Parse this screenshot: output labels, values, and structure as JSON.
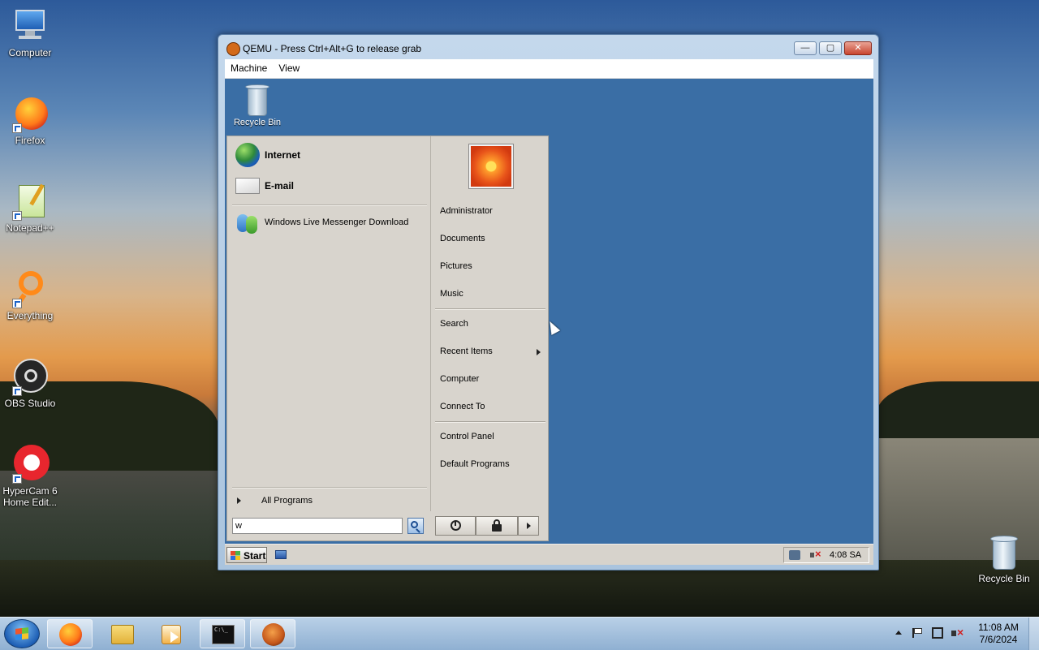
{
  "host_desktop": {
    "icons": [
      {
        "label": "Computer"
      },
      {
        "label": "Firefox"
      },
      {
        "label": "Notepad++"
      },
      {
        "label": "Everything"
      },
      {
        "label": "OBS Studio"
      },
      {
        "label": "HyperCam 6",
        "label2": "Home Edit..."
      },
      {
        "label": "Recycle Bin"
      }
    ]
  },
  "qemu_window": {
    "title": "QEMU - Press Ctrl+Alt+G to release grab",
    "menu": [
      "Machine",
      "View"
    ],
    "controls": {
      "minimize": "—",
      "maximize": "▢",
      "close": "✕"
    }
  },
  "guest": {
    "desktop_icons": [
      {
        "label": "Recycle Bin"
      }
    ],
    "start_menu": {
      "pinned": [
        {
          "label": "Internet",
          "icon": "globe-icon"
        },
        {
          "label": "E-mail",
          "icon": "mail-icon"
        }
      ],
      "programs": [
        {
          "label": "Windows Live Messenger Download",
          "icon": "messenger-icon"
        }
      ],
      "all_programs": "All Programs",
      "search_value": "w",
      "right_links": [
        "Administrator",
        "Documents",
        "Pictures",
        "Music",
        "Search",
        "Recent Items",
        "Computer",
        "Connect To",
        "Control Panel",
        "Default Programs"
      ]
    },
    "taskbar": {
      "start_label": "Start",
      "clock": "4:08 SA"
    }
  },
  "host_taskbar": {
    "clock_time": "11:08 AM",
    "clock_date": "7/6/2024"
  },
  "colors": {
    "guest_desktop": "#3a6ea5",
    "start_menu_bg": "#d8d4cd",
    "host_taskbar": "#8fb0d2"
  }
}
